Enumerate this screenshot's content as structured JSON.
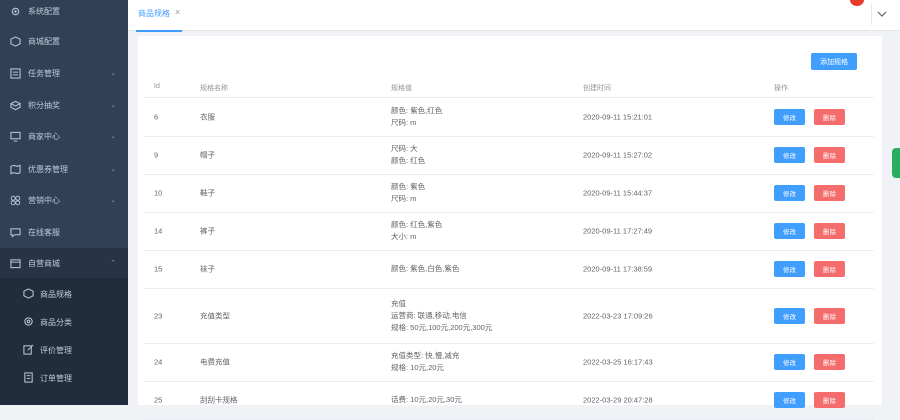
{
  "sidebar": {
    "items": [
      {
        "label": "系统配置",
        "icon": "gear-icon"
      },
      {
        "label": "商城配置",
        "icon": "cube-icon"
      },
      {
        "label": "任务管理",
        "icon": "list-icon"
      },
      {
        "label": "积分抽奖",
        "icon": "box-icon"
      },
      {
        "label": "商家中心",
        "icon": "monitor-icon"
      },
      {
        "label": "优惠券管理",
        "icon": "map-icon"
      },
      {
        "label": "营销中心",
        "icon": "grid-icon"
      },
      {
        "label": "在线客服",
        "icon": "chat-icon"
      },
      {
        "label": "自营商城",
        "icon": "folder-icon"
      }
    ],
    "sub_items": [
      {
        "label": "商品规格",
        "icon": "cube-icon"
      },
      {
        "label": "商品分类",
        "icon": "settings-icon"
      },
      {
        "label": "评价管理",
        "icon": "edit-icon"
      },
      {
        "label": "订单管理",
        "icon": "receipt-icon"
      }
    ]
  },
  "tabs": [
    {
      "label": "商品规格",
      "close": "×"
    }
  ],
  "table": {
    "add_button": "添加规格",
    "headers": [
      "Id",
      "规格名称",
      "规格值",
      "创建时间",
      "操作"
    ],
    "edit_label": "修改",
    "delete_label": "删除",
    "rows": [
      {
        "id": "6",
        "name": "衣服",
        "values": [
          "颜色: 紫色,红色",
          "尺码: m"
        ],
        "time": "2020-09-11 15:21:01"
      },
      {
        "id": "9",
        "name": "帽子",
        "values": [
          "尺码: 大",
          "颜色: 红色"
        ],
        "time": "2020-09-11 15:27:02"
      },
      {
        "id": "10",
        "name": "鞋子",
        "values": [
          "颜色: 紫色",
          "尺码: m"
        ],
        "time": "2020-09-11 15:44:37"
      },
      {
        "id": "14",
        "name": "裤子",
        "values": [
          "颜色: 红色,紫色",
          "大小: m"
        ],
        "time": "2020-09-11 17:27:49"
      },
      {
        "id": "15",
        "name": "袜子",
        "values": [
          "颜色: 紫色,白色,紫色"
        ],
        "time": "2020-09-11 17:38:59"
      },
      {
        "id": "23",
        "name": "充值类型",
        "values": [
          "充值",
          "运营商: 联通,移动,电信",
          "规格: 50元,100元,200元,300元"
        ],
        "time": "2022-03-23 17:09:26"
      },
      {
        "id": "24",
        "name": "电费充值",
        "values": [
          "充值类型: 快,慢,减充",
          "规格: 10元,20元"
        ],
        "time": "2022-03-25 16:17:43"
      },
      {
        "id": "25",
        "name": "刮刮卡规格",
        "values": [
          "话费: 10元,20元,30元"
        ],
        "time": "2022-03-29 20:47:28"
      }
    ]
  },
  "colors": {
    "sidebar_bg": "#304156",
    "accent": "#409eff",
    "danger": "#f56c6c"
  }
}
